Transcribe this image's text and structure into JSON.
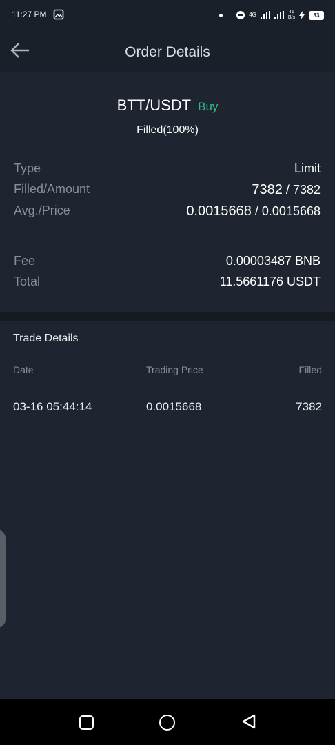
{
  "status_bar": {
    "time": "11:27 PM",
    "network_label": "4G",
    "speed_value": "41",
    "speed_unit": "B/s",
    "battery": "83"
  },
  "header": {
    "title": "Order Details",
    "back_icon": "arrow-left-icon"
  },
  "order": {
    "pair": "BTT/USDT",
    "side": "Buy",
    "status": "Filled(100%)",
    "type_label": "Type",
    "type_value": "Limit",
    "filled_label": "Filled/Amount",
    "filled_value": "7382",
    "amount_value": "7382",
    "price_label": "Avg./Price",
    "avg_price": "0.0015668",
    "price": "0.0015668",
    "fee_label": "Fee",
    "fee_value": "0.00003487 BNB",
    "total_label": "Total",
    "total_value": "11.5661176 USDT",
    "separator": "/"
  },
  "trade_details": {
    "title": "Trade Details",
    "columns": [
      "Date",
      "Trading Price",
      "Filled"
    ],
    "rows": [
      {
        "date": "03-16 05:44:14",
        "price": "0.0015668",
        "filled": "7382"
      }
    ]
  },
  "colors": {
    "background": "#1f2530",
    "buy": "#2ebd85",
    "label": "#848e9c"
  }
}
